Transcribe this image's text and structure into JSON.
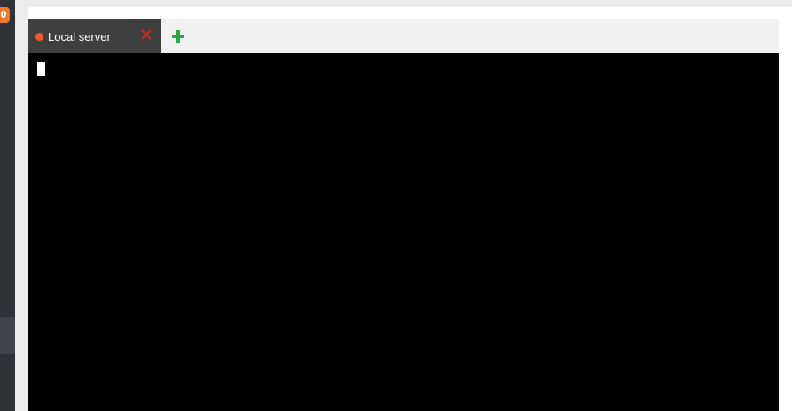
{
  "colors": {
    "sidebar_bg": "#2f3337",
    "brand_orange": "#f5792a",
    "tab_active_bg": "#3f3f3f",
    "tab_status_dot": "#f05a28",
    "tab_close": "#e2231a",
    "add_tab": "#28a745",
    "terminal_bg": "#000000",
    "terminal_cursor": "#ffffff"
  },
  "sidebar": {
    "logo_icon": "app-logo-icon"
  },
  "tabs": [
    {
      "label": "Local server",
      "status_icon": "status-dot-icon",
      "close_icon": "close-icon",
      "active": true
    }
  ],
  "toolbar": {
    "add_tab_icon": "plus-icon"
  },
  "terminal": {
    "output": ""
  }
}
